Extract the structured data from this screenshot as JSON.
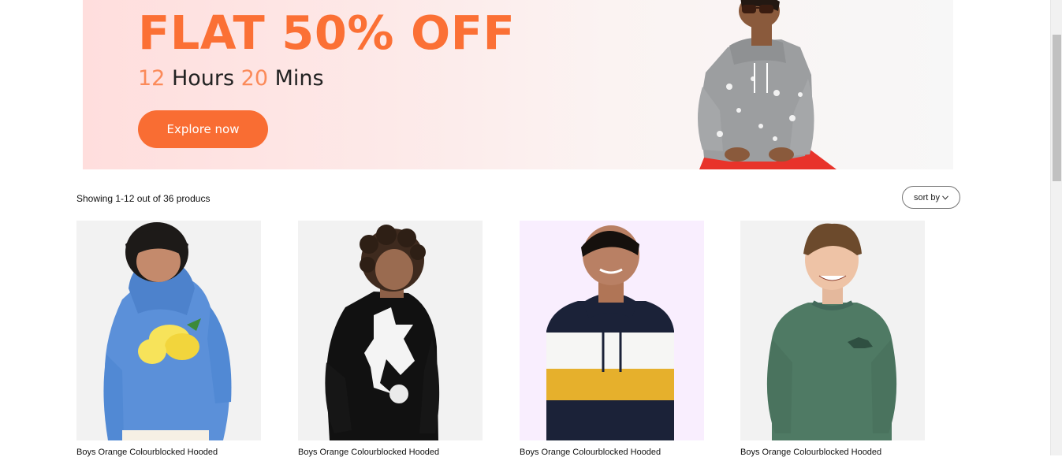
{
  "banner": {
    "title": "FLAT 50% OFF",
    "hours_value": "12",
    "hours_label": "Hours",
    "mins_value": "20",
    "mins_label": "Mins",
    "cta_label": "Explore now",
    "accent_color": "#fb7035"
  },
  "toolbar": {
    "result_count": "Showing 1-12 out of 36 producs",
    "sort_label": "sort by"
  },
  "products": [
    {
      "name": "Boys Orange Colourblocked Hooded"
    },
    {
      "name": "Boys Orange Colourblocked Hooded"
    },
    {
      "name": "Boys Orange Colourblocked Hooded"
    },
    {
      "name": "Boys Orange Colourblocked Hooded"
    }
  ],
  "icons": {
    "sort": "chevron-down-icon"
  }
}
